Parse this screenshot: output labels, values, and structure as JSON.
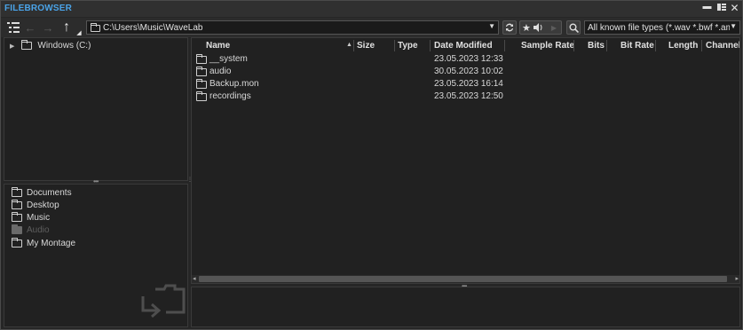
{
  "window": {
    "title": "FILEBROWSER"
  },
  "toolbar": {
    "path": "C:\\Users\\Music\\WaveLab",
    "filter": "All known file types (*.wav *.bwf *.am"
  },
  "tree": {
    "items": [
      {
        "label": "Windows (C:)"
      }
    ]
  },
  "favorites": {
    "items": [
      {
        "label": "Documents",
        "enabled": true
      },
      {
        "label": "Desktop",
        "enabled": true
      },
      {
        "label": "Music",
        "enabled": true
      },
      {
        "label": "Audio",
        "enabled": false
      },
      {
        "label": "My Montage",
        "enabled": true
      }
    ]
  },
  "filelist": {
    "columns": [
      "Name",
      "Size",
      "Type",
      "Date Modified",
      "Sample Rate",
      "Bits",
      "Bit Rate",
      "Length",
      "Channels"
    ],
    "rows": [
      {
        "name": "__system",
        "date": "23.05.2023 12:33"
      },
      {
        "name": "audio",
        "date": "30.05.2023 10:02"
      },
      {
        "name": "Backup.mon",
        "date": "23.05.2023 16:14"
      },
      {
        "name": "recordings",
        "date": "23.05.2023 12:50"
      }
    ]
  }
}
